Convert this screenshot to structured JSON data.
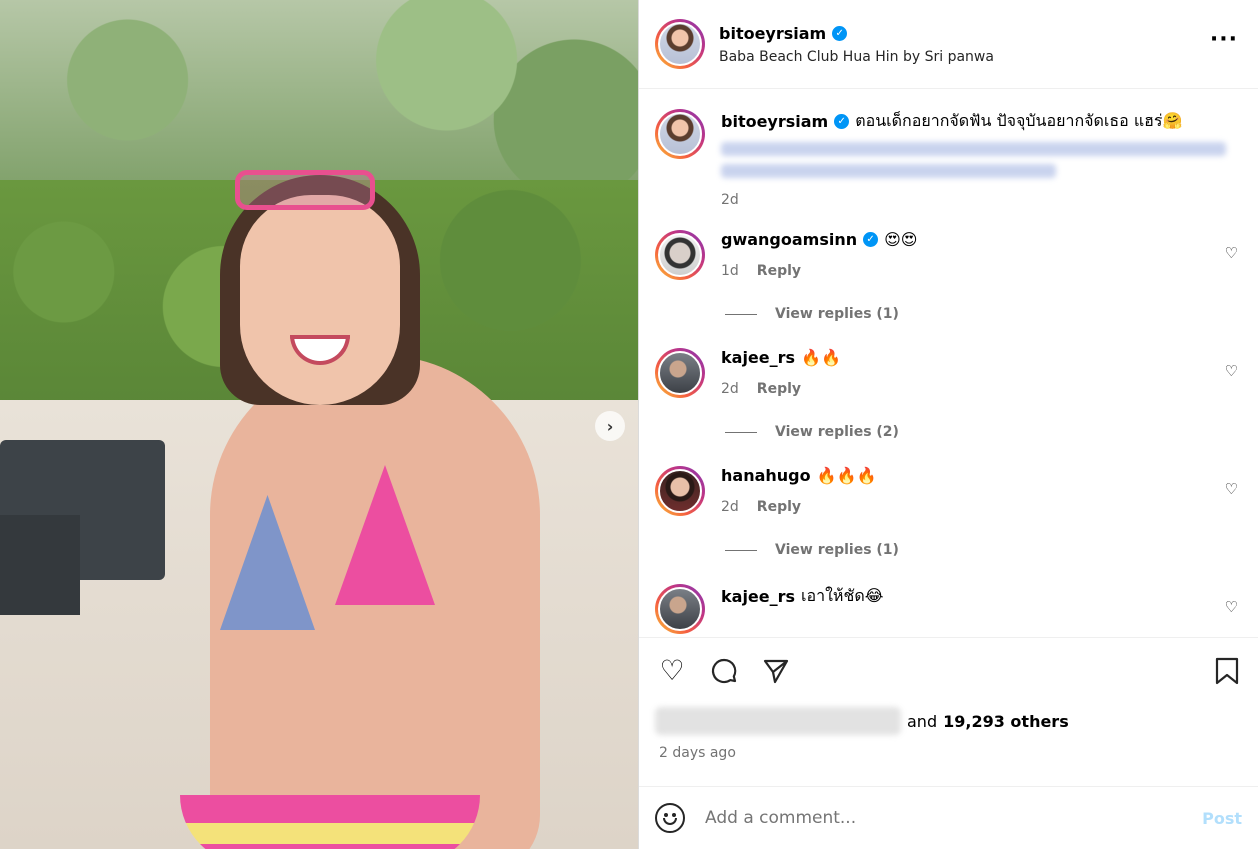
{
  "post": {
    "username": "bitoeyrsiam",
    "location": "Baba Beach Club Hua Hin by Sri panwa",
    "caption": "ตอนเด็กอยากจัดฟัน ปัจจุบันอยากจัดเธอ แฮร่🤗",
    "caption_time": "2d",
    "likes_others": "19,293 others",
    "likes_prefix": "and",
    "posted_ago": "2 days ago"
  },
  "comments": [
    {
      "username": "gwangoamsinn",
      "verified": true,
      "text": "😍😍",
      "time": "1d",
      "reply": "Reply",
      "view_replies": "View replies (1)"
    },
    {
      "username": "kajee_rs",
      "verified": false,
      "text": "🔥🔥",
      "time": "2d",
      "reply": "Reply",
      "view_replies": "View replies (2)"
    },
    {
      "username": "hanahugo",
      "verified": false,
      "text": "🔥🔥🔥",
      "time": "2d",
      "reply": "Reply",
      "view_replies": "View replies (1)"
    },
    {
      "username": "kajee_rs",
      "verified": false,
      "text": "เอาให้ชัด😂"
    }
  ],
  "composer": {
    "placeholder": "Add a comment...",
    "post_label": "Post"
  },
  "icons": {
    "more": "more-options-icon",
    "heart": "heart-icon",
    "comment": "comment-icon",
    "share": "share-icon",
    "save": "bookmark-icon",
    "emoji": "emoji-icon",
    "next": "chevron-right-icon",
    "verified": "verified-badge-icon"
  },
  "colors": {
    "verified": "#0095f6",
    "post_disabled": "#b2dffc",
    "muted": "#737373"
  }
}
